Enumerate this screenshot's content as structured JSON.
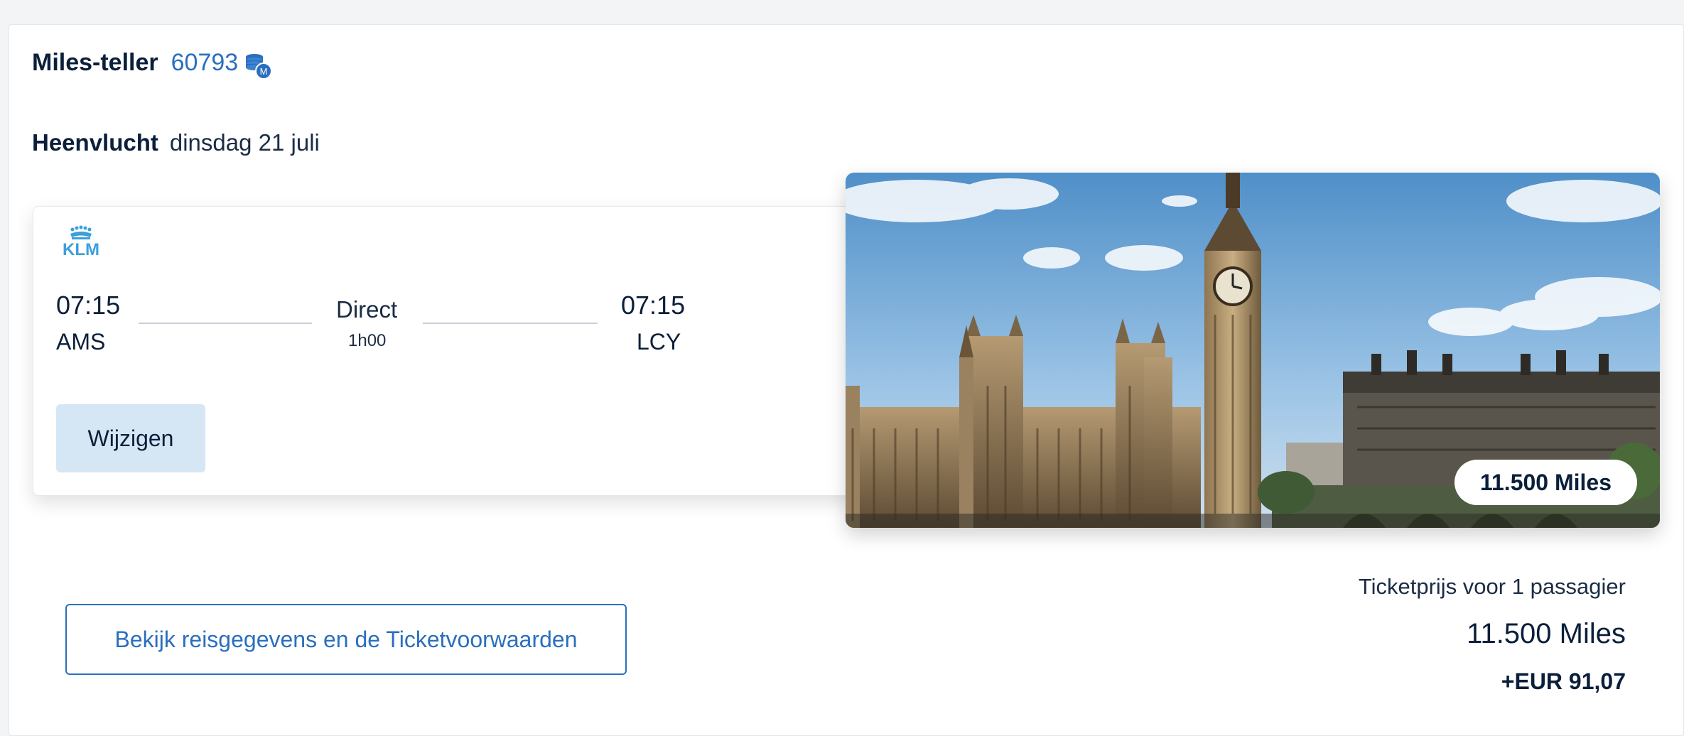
{
  "miles_counter": {
    "label": "Miles-teller",
    "value": "60793",
    "icon": "miles-coin-icon",
    "icon_badge": "M"
  },
  "flight": {
    "label": "Heenvlucht",
    "date": "dinsdag 21 juli",
    "airline_logo": "KLM",
    "departure_time": "07:15",
    "departure_airport": "AMS",
    "stops": "Direct",
    "duration": "1h00",
    "arrival_time": "07:15",
    "arrival_airport": "LCY",
    "change_button": "Wijzigen"
  },
  "destination_image": {
    "subject": "Big Ben and Houses of Parliament, London",
    "miles_badge": "11.500 Miles"
  },
  "details_button": "Bekijk reisgegevens en de Ticketvoorwaarden",
  "price": {
    "caption": "Ticketprijs voor 1 passagier",
    "miles": "11.500 Miles",
    "surcharge": "+EUR 91,07"
  },
  "colors": {
    "brand_blue": "#2a6fbd",
    "text_dark": "#0b1f3a",
    "button_light_blue": "#d5e6f5",
    "klm_blue": "#3aa0dc"
  }
}
